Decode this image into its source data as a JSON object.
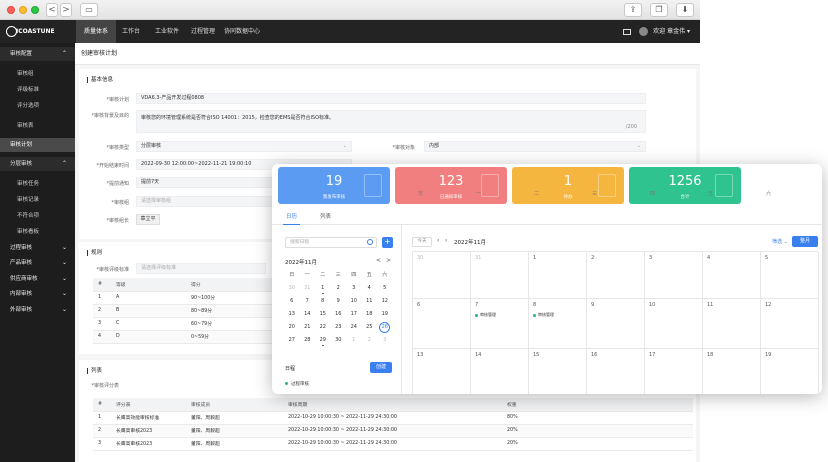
{
  "window": {
    "nav_back": "<",
    "nav_forward": ">",
    "icons": [
      "share-icon",
      "tabs-icon",
      "download-icon"
    ]
  },
  "topnav": {
    "logo": "ICOASTUNE",
    "items": [
      "质量体系",
      "工作台",
      "工业软件",
      "过程管理",
      "协同数据中心"
    ],
    "user": "欢迎 章金伟"
  },
  "sidebar": {
    "items": [
      {
        "label": "审核配置",
        "group": true
      },
      {
        "label": "审核组"
      },
      {
        "label": "评级标准"
      },
      {
        "label": "评分选项"
      },
      {
        "label": "审核表"
      },
      {
        "label": "审核计划"
      },
      {
        "label": "分层审核",
        "group": true
      },
      {
        "label": "审核任务"
      },
      {
        "label": "审核记录"
      },
      {
        "label": "不符合项"
      },
      {
        "label": "审核看板"
      },
      {
        "label": "过程审核",
        "group": true
      },
      {
        "label": "产品审核",
        "group": true
      },
      {
        "label": "供应商审核",
        "group": true
      },
      {
        "label": "内部审核",
        "group": true
      },
      {
        "label": "外部审核",
        "group": true
      }
    ]
  },
  "main": {
    "crumb": "创建审核计划",
    "basic": {
      "title": "基本信息",
      "plan_label": "*审核计划",
      "plan_value": "VDA6.3-产品开发过程0808",
      "bg_label": "*审核背景及目的",
      "bg_value": "审核您的环境管理系统是否符合ISO 14001：2015，检查您的EMS是否符合ISO标准。",
      "bg_count": "/200",
      "type_label": "*审核类型",
      "type_value": "分层审核",
      "object_label": "*审核对象",
      "object_value": "内部",
      "time_label": "*开始结束时间",
      "time_value": "2022-09-30 12:00:00~2022-11-21 19:00:10",
      "notify_label": "*提前通知",
      "notify_value": "提前7天",
      "group_label": "*审核组",
      "group_ph": "请选择审核组",
      "leader_label": "*审核组长",
      "leader_value": "章立平"
    },
    "rules": {
      "title": "规则",
      "std_label": "*审核评级标准",
      "std_ph": "请选择评级标准",
      "headers": [
        "#",
        "等级",
        "得分"
      ],
      "rows": [
        [
          "1",
          "A",
          "90~100分"
        ],
        [
          "2",
          "B",
          "80~89分"
        ],
        [
          "3",
          "C",
          "60~79分"
        ],
        [
          "4",
          "D",
          "0~59分"
        ]
      ]
    },
    "list": {
      "title": "列表",
      "table_label": "*审核评分表",
      "headers": [
        "#",
        "评分表",
        "审核成员",
        "审核周期",
        "权重"
      ],
      "rows": [
        [
          "1",
          "长鹰高效能审核标准",
          "董阳、周毅超",
          "2022-10-29 10:00:30 ~ 2022-11-29 24:30:00",
          "80%"
        ],
        [
          "2",
          "长鹰高审核2023",
          "董阳、周毅超",
          "2022-10-29 10:00:30 ~ 2022-11-29 24:30:00",
          "20%"
        ],
        [
          "3",
          "长鹰高审核2023",
          "董阳、周毅超",
          "2022-10-29 10:00:30 ~ 2022-11-29 24:30:00",
          "20%"
        ]
      ]
    }
  },
  "popup": {
    "stats": [
      {
        "value": "19",
        "label": "我发布审核",
        "color": "#5b9cf2"
      },
      {
        "value": "123",
        "label": "已通知审核",
        "color": "#f27f7f"
      },
      {
        "value": "1",
        "label": "待办",
        "color": "#f4b63f"
      },
      {
        "value": "1256",
        "label": "合计",
        "color": "#2ec38f"
      }
    ],
    "tabs": [
      "日历",
      "列表"
    ],
    "search_ph": "搜索日程",
    "add": "+",
    "mini_month": "2022年11月",
    "mini_nav_prev": "<",
    "mini_nav_next": ">",
    "weekdays": [
      "日",
      "一",
      "二",
      "三",
      "四",
      "五",
      "六"
    ],
    "mini_days": [
      [
        [
          "30",
          "o"
        ],
        [
          "31",
          "o"
        ],
        [
          "1",
          "e"
        ],
        [
          "2",
          ""
        ],
        [
          "3",
          ""
        ],
        [
          "4",
          ""
        ],
        [
          "5",
          ""
        ]
      ],
      [
        [
          "6",
          ""
        ],
        [
          "7",
          ""
        ],
        [
          "8",
          ""
        ],
        [
          "9",
          ""
        ],
        [
          "10",
          ""
        ],
        [
          "11",
          ""
        ],
        [
          "12",
          ""
        ]
      ],
      [
        [
          "13",
          ""
        ],
        [
          "14",
          ""
        ],
        [
          "15",
          ""
        ],
        [
          "16",
          ""
        ],
        [
          "17",
          ""
        ],
        [
          "18",
          ""
        ],
        [
          "19",
          ""
        ]
      ],
      [
        [
          "20",
          ""
        ],
        [
          "21",
          ""
        ],
        [
          "22",
          ""
        ],
        [
          "23",
          ""
        ],
        [
          "24",
          ""
        ],
        [
          "25",
          ""
        ],
        [
          "26",
          "t"
        ]
      ],
      [
        [
          "27",
          ""
        ],
        [
          "28",
          ""
        ],
        [
          "29",
          "e"
        ],
        [
          "30",
          ""
        ],
        [
          "1",
          "o"
        ],
        [
          "2",
          "o"
        ],
        [
          "3",
          "o"
        ]
      ]
    ],
    "schedule_label": "日程",
    "create_btn": "创建",
    "schedule_item": "过程审核",
    "today_btn": "今天",
    "big_month": "2022年11月",
    "filter": "筛选",
    "month_btn": "整月",
    "big_weekdays": [
      "日",
      "一",
      "二",
      "三",
      "四",
      "五",
      "六"
    ],
    "big_days": [
      [
        "30",
        "o"
      ],
      [
        "31",
        "o"
      ],
      [
        "1",
        ""
      ],
      [
        "2",
        ""
      ],
      [
        "3",
        ""
      ],
      [
        "4",
        ""
      ],
      [
        "5",
        ""
      ],
      [
        "6",
        ""
      ],
      [
        "7",
        ""
      ],
      [
        "8",
        ""
      ],
      [
        "9",
        ""
      ],
      [
        "10",
        ""
      ],
      [
        "11",
        ""
      ],
      [
        "12",
        ""
      ],
      [
        "13",
        ""
      ],
      [
        "14",
        ""
      ],
      [
        "15",
        ""
      ],
      [
        "16",
        ""
      ],
      [
        "17",
        ""
      ],
      [
        "18",
        ""
      ],
      [
        "19",
        ""
      ]
    ],
    "events": [
      {
        "day_index": 8,
        "label": "审核管理"
      },
      {
        "day_index": 9,
        "label": "审核管理"
      }
    ]
  }
}
